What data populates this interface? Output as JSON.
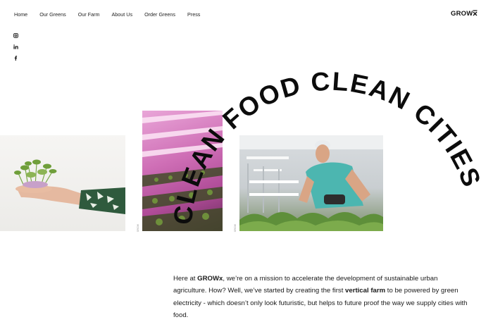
{
  "nav": {
    "items": [
      "Home",
      "Our Greens",
      "Our Farm",
      "About Us",
      "Order Greens",
      "Press"
    ]
  },
  "logo": {
    "text": "GROW",
    "mark": "x"
  },
  "social": [
    "instagram-icon",
    "linkedin-icon",
    "facebook-icon"
  ],
  "hero": {
    "arc_text": "CLEAN FOOD CLEAN CITIES",
    "photo_tag_1": "GROW",
    "photo_tag_2": "GROW"
  },
  "intro": {
    "p1": "Here at ",
    "brand": "GROWx",
    "p2": ", we’re on a mission to accelerate the development of sustainable urban agriculture. How? Well, we’ve started by creating the first ",
    "highlight": "vertical farm",
    "p3": " to be powered by green electricity - which doesn’t only look futuristic, but helps to future proof the way we supply cities with food."
  },
  "colors": {
    "text": "#111111",
    "background": "#ffffff",
    "pink_light": "#d66fbf",
    "teal_shirt": "#4cb6b0"
  }
}
